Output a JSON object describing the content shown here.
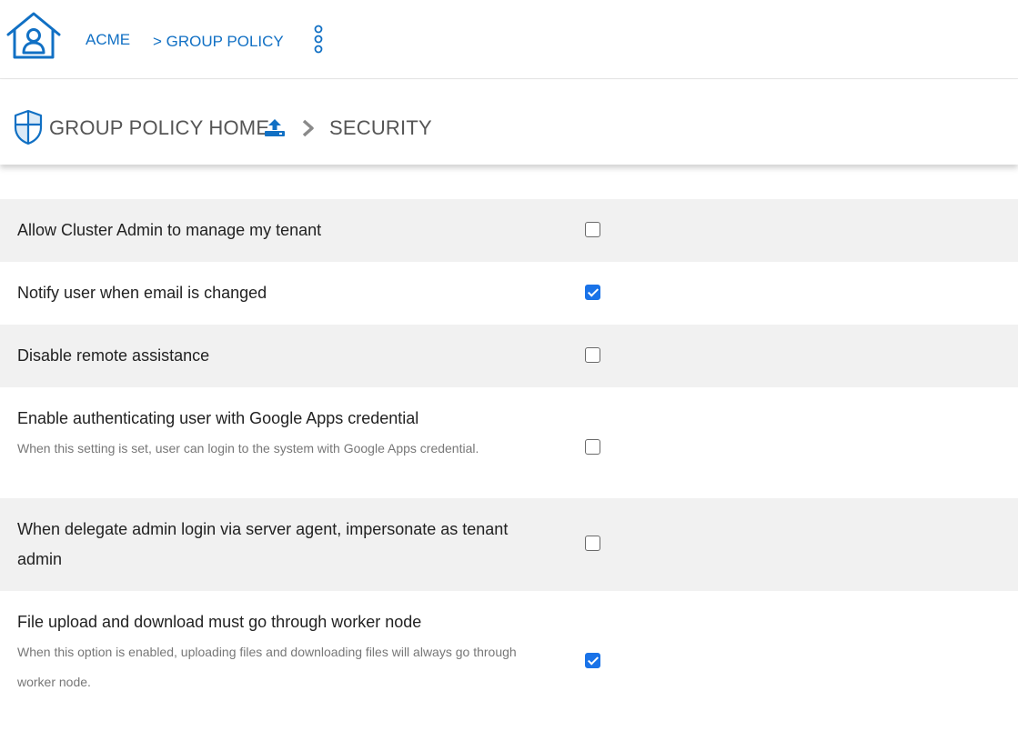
{
  "header": {
    "org": "ACME",
    "crumb": "> GROUP POLICY",
    "home_icon": "home-user-icon",
    "menu_icon": "kebab-menu-icon"
  },
  "subheader": {
    "home_label": "GROUP POLICY HOME",
    "current": "SECURITY",
    "shield_icon": "shield-icon",
    "upload_icon": "upload-icon",
    "separator_icon": "chevron-right-icon"
  },
  "settings": [
    {
      "title": "Allow Cluster Admin to manage my tenant",
      "checked": false
    },
    {
      "title": "Notify user when email is changed",
      "checked": true
    },
    {
      "title": "Disable remote assistance",
      "checked": false
    },
    {
      "title": "Enable authenticating user with Google Apps credential",
      "description": "When this setting is set, user can login to the system with Google Apps credential.",
      "checked": false
    },
    {
      "title": "When delegate admin login via server agent, impersonate as tenant admin",
      "checked": false
    },
    {
      "title": "File upload and download must go through worker node",
      "description": "When this option is enabled, uploading files and downloading files will always go through worker node.",
      "checked": true
    }
  ],
  "colors": {
    "accent": "#1170c4",
    "checkbox_checked": "#1a73e8",
    "row_shade": "#f1f1f1"
  }
}
